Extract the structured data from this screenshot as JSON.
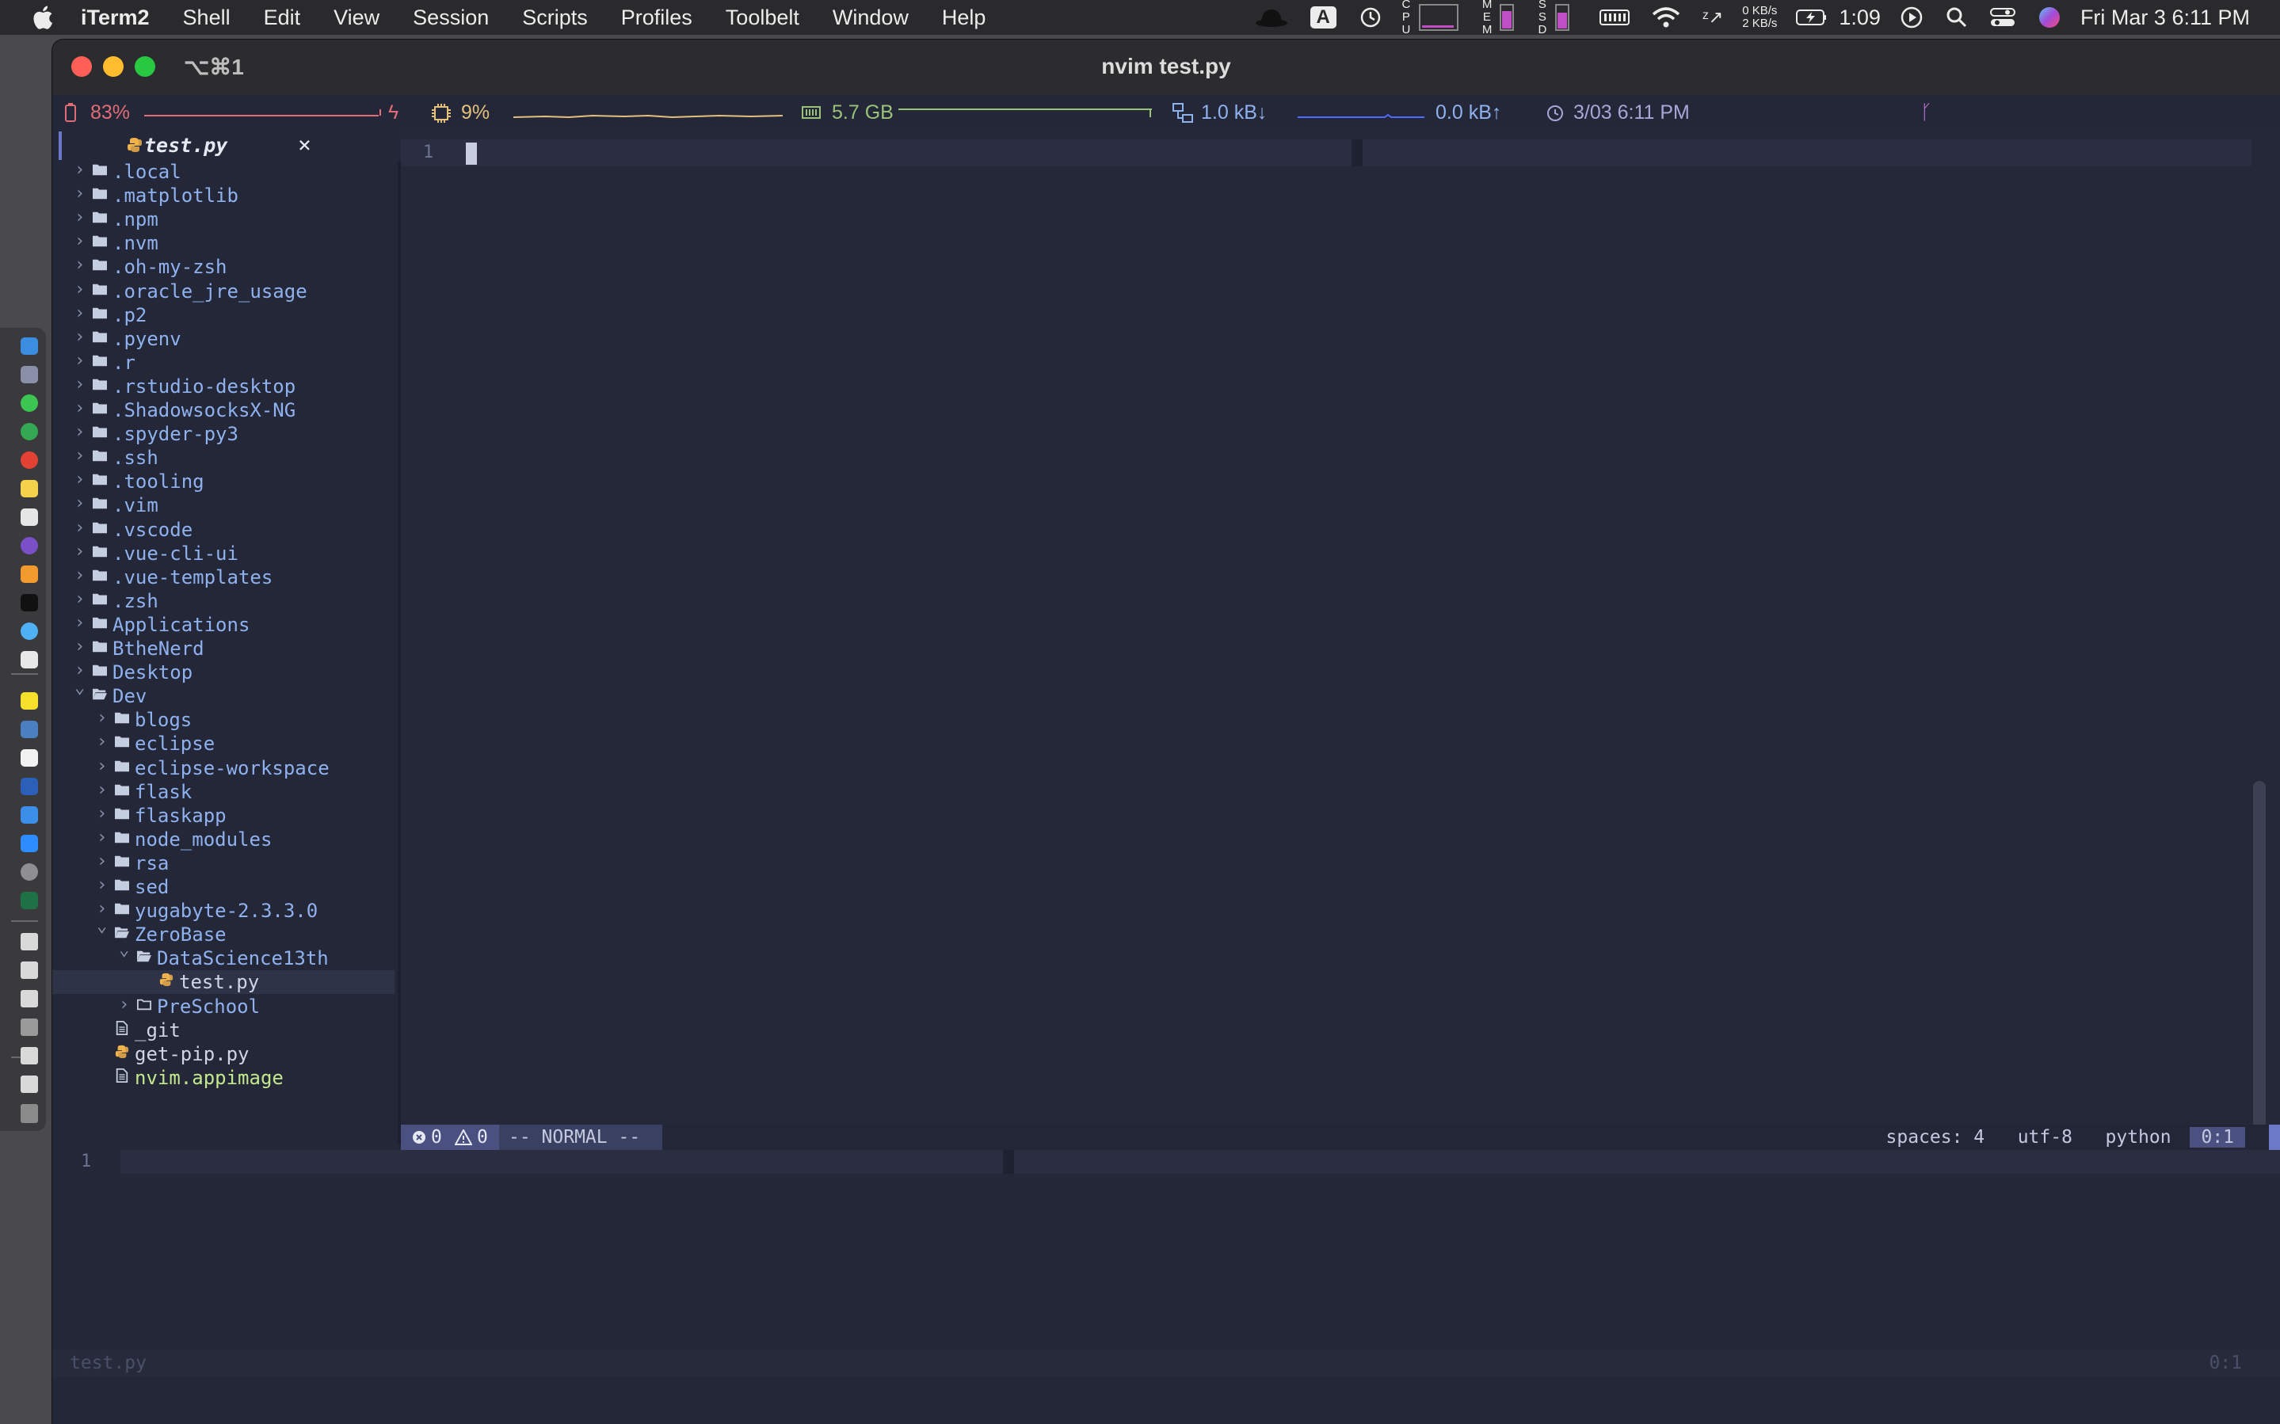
{
  "menubar": {
    "app_name": "iTerm2",
    "menus": [
      "Shell",
      "Edit",
      "View",
      "Session",
      "Scripts",
      "Profiles",
      "Toolbelt",
      "Window",
      "Help"
    ],
    "status": {
      "input_source": "A",
      "net_down": "0 KB/s",
      "net_up": "2 KB/s",
      "battery_time": "1:09",
      "clock": "Fri Mar 3  6:11 PM",
      "cpu_label": "CPU",
      "mem_label": "MEM",
      "ssd_label": "SSD"
    }
  },
  "window": {
    "tab_shortcut": "⌥⌘1",
    "title": "nvim test.py"
  },
  "statusbar": {
    "battery": "83%",
    "cpu": "9%",
    "memory": "5.7 GB",
    "net_down": "1.0 kB↓",
    "net_up": "0.0 kB↑",
    "datetime": "3/03 6:11 PM",
    "battery_level": 0.83,
    "cpu_level": 0.09
  },
  "tree": {
    "tab_file": "test.py",
    "rows": [
      {
        "name": ".local",
        "type": "dir",
        "depth": 0
      },
      {
        "name": ".matplotlib",
        "type": "dir",
        "depth": 0
      },
      {
        "name": ".npm",
        "type": "dir",
        "depth": 0
      },
      {
        "name": ".nvm",
        "type": "dir",
        "depth": 0
      },
      {
        "name": ".oh-my-zsh",
        "type": "dir",
        "depth": 0
      },
      {
        "name": ".oracle_jre_usage",
        "type": "dir",
        "depth": 0
      },
      {
        "name": ".p2",
        "type": "dir",
        "depth": 0
      },
      {
        "name": ".pyenv",
        "type": "dir",
        "depth": 0
      },
      {
        "name": ".r",
        "type": "dir",
        "depth": 0
      },
      {
        "name": ".rstudio-desktop",
        "type": "dir",
        "depth": 0
      },
      {
        "name": ".ShadowsocksX-NG",
        "type": "dir",
        "depth": 0
      },
      {
        "name": ".spyder-py3",
        "type": "dir",
        "depth": 0
      },
      {
        "name": ".ssh",
        "type": "dir",
        "depth": 0
      },
      {
        "name": ".tooling",
        "type": "dir",
        "depth": 0
      },
      {
        "name": ".vim",
        "type": "dir",
        "depth": 0
      },
      {
        "name": ".vscode",
        "type": "dir",
        "depth": 0
      },
      {
        "name": ".vue-cli-ui",
        "type": "dir",
        "depth": 0
      },
      {
        "name": ".vue-templates",
        "type": "dir",
        "depth": 0
      },
      {
        "name": ".zsh",
        "type": "dir",
        "depth": 0
      },
      {
        "name": "Applications",
        "type": "dir",
        "depth": 0
      },
      {
        "name": "BtheNerd",
        "type": "dir",
        "depth": 0
      },
      {
        "name": "Desktop",
        "type": "dir",
        "depth": 0
      },
      {
        "name": "Dev",
        "type": "dir-open",
        "depth": 0
      },
      {
        "name": "blogs",
        "type": "dir",
        "depth": 1
      },
      {
        "name": "eclipse",
        "type": "dir",
        "depth": 1
      },
      {
        "name": "eclipse-workspace",
        "type": "dir",
        "depth": 1
      },
      {
        "name": "flask",
        "type": "dir",
        "depth": 1
      },
      {
        "name": "flaskapp",
        "type": "dir",
        "depth": 1
      },
      {
        "name": "node_modules",
        "type": "dir",
        "depth": 1
      },
      {
        "name": "rsa",
        "type": "dir",
        "depth": 1
      },
      {
        "name": "sed",
        "type": "dir",
        "depth": 1
      },
      {
        "name": "yugabyte-2.3.3.0",
        "type": "dir",
        "depth": 1
      },
      {
        "name": "ZeroBase",
        "type": "dir-open",
        "depth": 1
      },
      {
        "name": "DataScience13th",
        "type": "dir-open",
        "depth": 2
      },
      {
        "name": "test.py",
        "type": "py",
        "depth": 3,
        "selected": true
      },
      {
        "name": "PreSchool",
        "type": "dir-empty",
        "depth": 2
      },
      {
        "name": "_git",
        "type": "file",
        "depth": 1
      },
      {
        "name": "get-pip.py",
        "type": "py",
        "depth": 1
      },
      {
        "name": "nvim.appimage",
        "type": "file-green",
        "depth": 1
      }
    ]
  },
  "editor": {
    "line_number": "1",
    "statusline": {
      "errors": "0",
      "warnings": "0",
      "mode": "-- NORMAL --",
      "indent": "spaces: 4",
      "encoding": "utf-8",
      "filetype": "python",
      "position": "0:1"
    }
  },
  "term": {
    "line_number": "1",
    "file": "test.py",
    "position": "0:1"
  },
  "colors": {
    "window_bg": "#232738",
    "dir_text": "#8fb2ef",
    "accent": "#6b79c8",
    "python_icon": "#f0b24b"
  }
}
